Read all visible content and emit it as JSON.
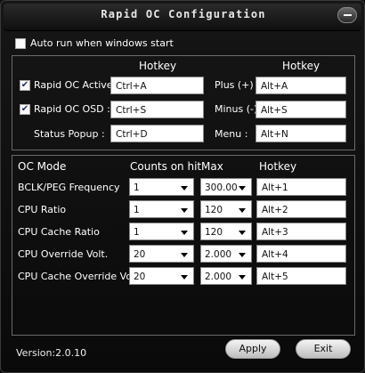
{
  "window": {
    "title": "Rapid OC Configuration"
  },
  "autorun": {
    "label": "Auto run when windows start",
    "checked": false
  },
  "hotkey_panel": {
    "col_header_left": "Hotkey",
    "col_header_right": "Hotkey",
    "rows": [
      {
        "label": "Rapid OC Active :",
        "checked": true,
        "hotkey": "Ctrl+A",
        "right_label": "Plus (+) :",
        "right_hotkey": "Alt+A"
      },
      {
        "label": "Rapid OC OSD :",
        "checked": true,
        "hotkey": "Ctrl+S",
        "right_label": "Minus (-) :",
        "right_hotkey": "Alt+S"
      },
      {
        "label": "Status Popup :",
        "checked": null,
        "hotkey": "Ctrl+D",
        "right_label": "Menu :",
        "right_hotkey": "Alt+N"
      }
    ]
  },
  "oc_panel": {
    "headers": {
      "mode": "OC Mode",
      "counts": "Counts on hit",
      "max": "Max",
      "hotkey": "Hotkey"
    },
    "rows": [
      {
        "mode": "BCLK/PEG Frequency",
        "counts": "1",
        "max": "300.00",
        "hotkey": "Alt+1"
      },
      {
        "mode": "CPU Ratio",
        "counts": "1",
        "max": "120",
        "hotkey": "Alt+2"
      },
      {
        "mode": "CPU Cache Ratio",
        "counts": "1",
        "max": "120",
        "hotkey": "Alt+3"
      },
      {
        "mode": "CPU Override Volt.",
        "counts": "20",
        "max": "2.000",
        "hotkey": "Alt+4"
      },
      {
        "mode": "CPU Cache Override Volt.",
        "counts": "20",
        "max": "2.000",
        "hotkey": "Alt+5"
      }
    ]
  },
  "footer": {
    "version": "Version:2.0.10",
    "apply_label": "Apply",
    "exit_label": "Exit"
  }
}
